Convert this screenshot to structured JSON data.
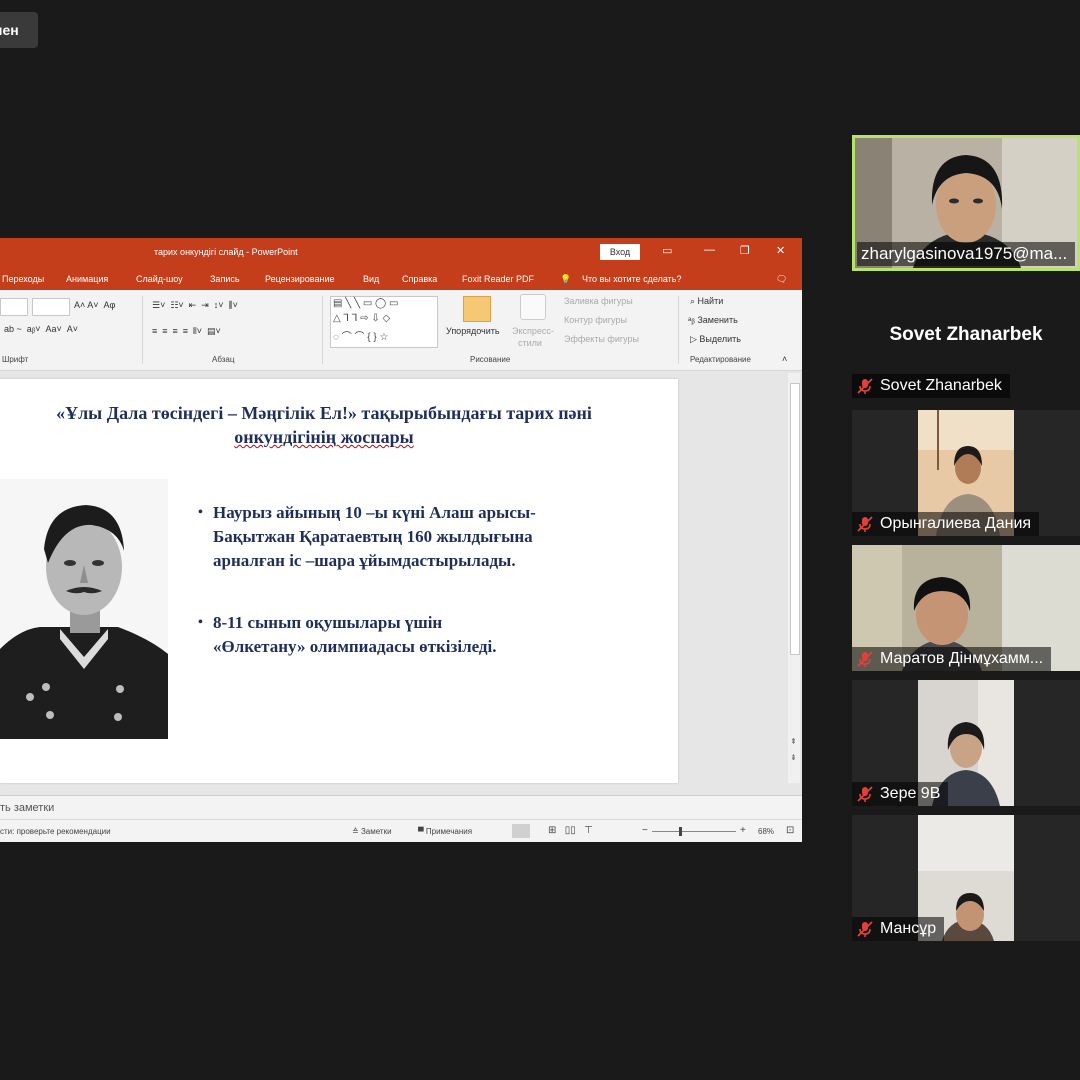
{
  "top_badge": "нен",
  "ppt": {
    "window_title": "тарих онкундігі слайд  -  PowerPoint",
    "signin": "Вход",
    "tabs": [
      "Переходы",
      "Анимация",
      "Слайд-шоу",
      "Запись",
      "Рецензирование",
      "Вид",
      "Справка",
      "Foxit Reader PDF"
    ],
    "tell_me": "Что вы хотите сделать?",
    "groups": {
      "font": "Шрифт",
      "paragraph": "Абзац",
      "drawing": "Рисование",
      "editing": "Редактирование"
    },
    "drawing": {
      "arrange": "Упорядочить",
      "quick_styles_1": "Экспресс-",
      "quick_styles_2": "стили",
      "fill": "Заливка фигуры",
      "outline": "Контур фигуры",
      "effects": "Эффекты фигуры"
    },
    "editing": {
      "find": "Найти",
      "replace": "Заменить",
      "select": "Выделить"
    },
    "slide": {
      "title_line1": "«Ұлы Дала төсіндегі – Мәңгілік Ел!» тақырыбындағы тарих пәні",
      "title_line2": "онкундігінің жоспары",
      "bullets": [
        {
          "line1": "Наурыз айының 10 –ы күні Алаш арысы-",
          "line2": "Бақытжан Қаратаевтың 160 жылдығына",
          "line3": "арналған іс –шара ұйымдастырылады."
        },
        {
          "line1": "8-11 сынып оқушылары үшін",
          "line2": "«Өлкетану» олимпиадасы өткізіледі."
        }
      ]
    },
    "notes_placeholder": "ть заметки",
    "status": {
      "accessibility": "сти: проверьте рекомендации",
      "notes": "Заметки",
      "comments": "Примечания",
      "zoom": "68%"
    }
  },
  "participants": {
    "host": {
      "name": "zharylgasinova1975@ma..."
    },
    "speaker_name_large": "Sovet Zhanarbek",
    "list": [
      {
        "name": "Sovet Zhanarbek",
        "muted": true
      },
      {
        "name": "Орынгалиева Дания",
        "muted": true
      },
      {
        "name": "Маратов Дінмұхамм...",
        "muted": true
      },
      {
        "name": "Зере 9В",
        "muted": true
      },
      {
        "name": "Мансұр",
        "muted": true
      }
    ]
  },
  "colors": {
    "ppt_accent": "#c43e1c",
    "slide_text": "#1f2e5b",
    "active_speaker_border": "#b7e36a",
    "mute_red": "#e0413b"
  }
}
